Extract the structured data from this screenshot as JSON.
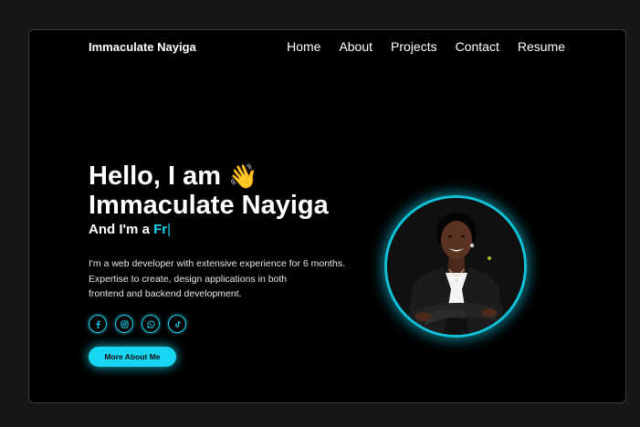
{
  "header": {
    "brand": "Immaculate Nayiga",
    "nav": [
      "Home",
      "About",
      "Projects",
      "Contact",
      "Resume"
    ]
  },
  "hero": {
    "greeting": "Hello, I am",
    "wave_emoji": "👋",
    "name": "Immaculate Nayiga",
    "role_prefix": "And I'm a ",
    "role_typed": "Fr",
    "cursor": "|",
    "bio_lines": [
      "I'm a web developer with extensive experience for 6 months.",
      "Expertise to create, design applications in both",
      "frontend and backend development."
    ],
    "socials": [
      "facebook-icon",
      "instagram-icon",
      "whatsapp-icon",
      "tiktok-icon"
    ],
    "button_label": "More About Me"
  },
  "colors": {
    "accent": "#18d6f2",
    "background": "#000000",
    "page": "#161616"
  }
}
